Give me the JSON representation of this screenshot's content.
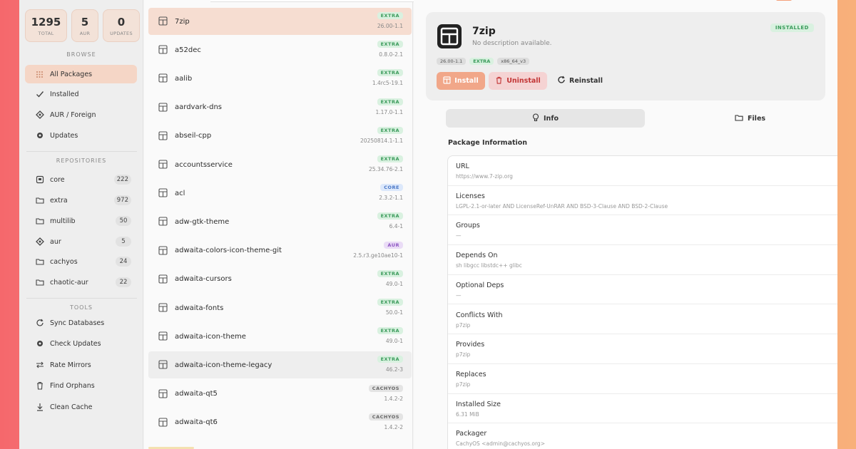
{
  "stats": [
    {
      "value": "1295",
      "label": "TOTAL"
    },
    {
      "value": "5",
      "label": "AUR"
    },
    {
      "value": "0",
      "label": "UPDATES"
    }
  ],
  "browse": {
    "title": "BROWSE",
    "items": [
      {
        "label": "All Packages",
        "icon": "grid-icon"
      },
      {
        "label": "Installed",
        "icon": "check-icon"
      },
      {
        "label": "AUR / Foreign",
        "icon": "globe-icon"
      },
      {
        "label": "Updates",
        "icon": "gear-icon"
      }
    ]
  },
  "repositories": {
    "title": "REPOSITORIES",
    "items": [
      {
        "label": "core",
        "count": "222",
        "icon": "database-icon"
      },
      {
        "label": "extra",
        "count": "972",
        "icon": "folder-icon"
      },
      {
        "label": "multilib",
        "count": "50",
        "icon": "folder-icon"
      },
      {
        "label": "aur",
        "count": "5",
        "icon": "globe-icon"
      },
      {
        "label": "cachyos",
        "count": "24",
        "icon": "folder-icon"
      },
      {
        "label": "chaotic-aur",
        "count": "22",
        "icon": "folder-icon"
      }
    ]
  },
  "tools": {
    "title": "TOOLS",
    "items": [
      {
        "label": "Sync Databases",
        "icon": "refresh-icon"
      },
      {
        "label": "Check Updates",
        "icon": "gear-icon"
      },
      {
        "label": "Rate Mirrors",
        "icon": "swap-icon"
      },
      {
        "label": "Find Orphans",
        "icon": "trash-icon"
      },
      {
        "label": "Clean Cache",
        "icon": "download-icon"
      }
    ]
  },
  "packages": [
    {
      "name": "7zip",
      "repo": "EXTRA",
      "version": "26.00-1.1"
    },
    {
      "name": "a52dec",
      "repo": "EXTRA",
      "version": "0.8.0-2.1"
    },
    {
      "name": "aalib",
      "repo": "EXTRA",
      "version": "1.4rc5-19.1"
    },
    {
      "name": "aardvark-dns",
      "repo": "EXTRA",
      "version": "1.17.0-1.1"
    },
    {
      "name": "abseil-cpp",
      "repo": "EXTRA",
      "version": "20250814.1-1.1"
    },
    {
      "name": "accountsservice",
      "repo": "EXTRA",
      "version": "25.34.76-2.1"
    },
    {
      "name": "acl",
      "repo": "CORE",
      "version": "2.3.2-1.1"
    },
    {
      "name": "adw-gtk-theme",
      "repo": "EXTRA",
      "version": "6.4-1"
    },
    {
      "name": "adwaita-colors-icon-theme-git",
      "repo": "AUR",
      "version": "2.5.r3.ge10ae10-1"
    },
    {
      "name": "adwaita-cursors",
      "repo": "EXTRA",
      "version": "49.0-1"
    },
    {
      "name": "adwaita-fonts",
      "repo": "EXTRA",
      "version": "50.0-1"
    },
    {
      "name": "adwaita-icon-theme",
      "repo": "EXTRA",
      "version": "49.0-1"
    },
    {
      "name": "adwaita-icon-theme-legacy",
      "repo": "EXTRA",
      "version": "46.2-3"
    },
    {
      "name": "adwaita-qt5",
      "repo": "CACHYOS",
      "version": "1.4.2-2"
    },
    {
      "name": "adwaita-qt6",
      "repo": "CACHYOS",
      "version": "1.4.2-2"
    }
  ],
  "detail": {
    "name": "7zip",
    "description": "No description available.",
    "status": "INSTALLED",
    "tags": [
      "26.00-1.1",
      "EXTRA",
      "x86_64_v3"
    ],
    "install_label": "Install",
    "uninstall_label": "Uninstall",
    "reinstall_label": "Reinstall",
    "tab_info": "Info",
    "tab_files": "Files",
    "section_title": "Package Information",
    "rows": [
      {
        "key": "URL",
        "value": "https://www.7-zip.org"
      },
      {
        "key": "Licenses",
        "value": "LGPL-2.1-or-later AND LicenseRef-UnRAR AND BSD-3-Clause AND BSD-2-Clause"
      },
      {
        "key": "Groups",
        "value": "—"
      },
      {
        "key": "Depends On",
        "value": "sh  libgcc  libstdc++  glibc"
      },
      {
        "key": "Optional Deps",
        "value": "—"
      },
      {
        "key": "Conflicts With",
        "value": "p7zip"
      },
      {
        "key": "Provides",
        "value": "p7zip"
      },
      {
        "key": "Replaces",
        "value": "p7zip"
      },
      {
        "key": "Installed Size",
        "value": "6.31 MiB"
      },
      {
        "key": "Packager",
        "value": "CachyOS <admin@cachyos.org>"
      }
    ]
  },
  "colors": {
    "accent": "#f1a789",
    "extra": "#3a9a5a",
    "core": "#4a77c6",
    "aur": "#8e57c2"
  }
}
